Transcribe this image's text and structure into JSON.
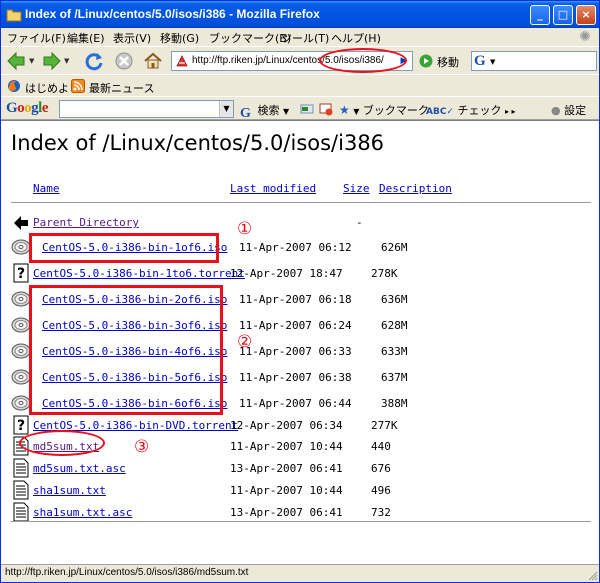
{
  "window": {
    "title": "Index of /Linux/centos/5.0/isos/i386 - Mozilla Firefox",
    "controls": {
      "minimize": "_",
      "maximize": "□",
      "close": "×"
    }
  },
  "menu": [
    "ファイル(F)",
    "編集(E)",
    "表示(V)",
    "移動(G)",
    "ブックマーク(B)",
    "ツール(T)",
    "ヘルプ(H)"
  ],
  "nav": {
    "url": "http://ftp.riken.jp/Linux/centos/5.0/isos/i386/",
    "go_label": "移動",
    "search_engine": "G"
  },
  "bookmarks": [
    {
      "label": "はじめよう",
      "icon": "firefox-icon"
    },
    {
      "label": "最新ニュース",
      "icon": "rss-feed-icon"
    }
  ],
  "google_toolbar": {
    "logo": [
      "G",
      "o",
      "o",
      "g",
      "l",
      "e"
    ],
    "logo_colors": [
      "#1f4ea8",
      "#c8201a",
      "#e0a800",
      "#1f4ea8",
      "#2a8a2a",
      "#c8201a"
    ],
    "search_label": "検索",
    "bookmark_label": "ブックマーク",
    "check_label": "チェック",
    "settings_label": "設定"
  },
  "page": {
    "title": "Index of /Linux/centos/5.0/isos/i386",
    "columns": {
      "name": "Name",
      "modified": "Last modified",
      "size": "Size",
      "description": "Description"
    },
    "rows": [
      {
        "name": "Parent Directory",
        "date": "",
        "size": "-",
        "icon": "back-arrow-icon",
        "visited": true
      },
      {
        "name": "CentOS-5.0-i386-bin-1of6.iso",
        "date": "11-Apr-2007 06:12",
        "size": "626M",
        "icon": "cd-icon",
        "visited": false
      },
      {
        "name": "CentOS-5.0-i386-bin-1to6.torrent",
        "date": "12-Apr-2007 18:47",
        "size": "278K",
        "icon": "unknown-file-icon",
        "visited": false
      },
      {
        "name": "CentOS-5.0-i386-bin-2of6.iso",
        "date": "11-Apr-2007 06:18",
        "size": "636M",
        "icon": "cd-icon",
        "visited": false
      },
      {
        "name": "CentOS-5.0-i386-bin-3of6.iso",
        "date": "11-Apr-2007 06:24",
        "size": "628M",
        "icon": "cd-icon",
        "visited": false
      },
      {
        "name": "CentOS-5.0-i386-bin-4of6.iso",
        "date": "11-Apr-2007 06:33",
        "size": "633M",
        "icon": "cd-icon",
        "visited": false
      },
      {
        "name": "CentOS-5.0-i386-bin-5of6.iso",
        "date": "11-Apr-2007 06:38",
        "size": "637M",
        "icon": "cd-icon",
        "visited": false
      },
      {
        "name": "CentOS-5.0-i386-bin-6of6.iso",
        "date": "11-Apr-2007 06:44",
        "size": "388M",
        "icon": "cd-icon",
        "visited": false
      },
      {
        "name": "CentOS-5.0-i386-bin-DVD.torrent",
        "date": "12-Apr-2007 06:34",
        "size": "277K",
        "icon": "unknown-file-icon",
        "visited": false
      },
      {
        "name": "md5sum.txt",
        "date": "11-Apr-2007 10:44",
        "size": "440",
        "icon": "text-file-icon",
        "visited": true
      },
      {
        "name": "md5sum.txt.asc",
        "date": "13-Apr-2007 06:41",
        "size": "676",
        "icon": "text-file-icon",
        "visited": false
      },
      {
        "name": "sha1sum.txt",
        "date": "11-Apr-2007 10:44",
        "size": "496",
        "icon": "text-file-icon",
        "visited": false
      },
      {
        "name": "sha1sum.txt.asc",
        "date": "13-Apr-2007 06:41",
        "size": "732",
        "icon": "text-file-icon",
        "visited": false
      }
    ]
  },
  "annotations": {
    "mark1": "①",
    "mark2": "②",
    "mark3": "③"
  },
  "status": {
    "text": "http://ftp.riken.jp/Linux/centos/5.0/isos/i386/md5sum.txt"
  },
  "colors": {
    "annotation": "#e8101a",
    "link": "#0000cc",
    "visited": "#551a8b",
    "titlebar": "#0054e3"
  }
}
